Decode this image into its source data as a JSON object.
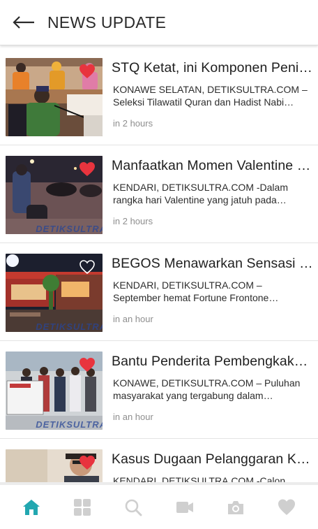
{
  "header": {
    "title": "NEWS UPDATE",
    "back_icon": "arrow-left-icon"
  },
  "articles": [
    {
      "title": "STQ Ketat, ini Komponen Penilaian",
      "excerpt": "KONAWE SELATAN, DETIKSULTRA.COM – Seleksi Tilawatil Quran dan Hadist Nabi…",
      "time": "in 2 hours",
      "favorited": true,
      "watermark": ""
    },
    {
      "title": "Manfaatkan Momen Valentine Day",
      "excerpt": "KENDARI, DETIKSULTRA.COM -Dalam rangka hari Valentine yang jatuh pada…",
      "time": "in 2 hours",
      "favorited": true,
      "watermark": "DETIKSULTRA"
    },
    {
      "title": "BEGOS Menawarkan Sensasi Baru",
      "excerpt": "KENDARI, DETIKSULTRA.COM – September hemat Fortune Frontone…",
      "time": "in an hour",
      "favorited": false,
      "watermark": "DETIKSULTRA"
    },
    {
      "title": "Bantu Penderita Pembengkakan Otak",
      "excerpt": "KONAWE, DETIKSULTRA.COM – Puluhan masyarakat yang tergabung dalam…",
      "time": "in an hour",
      "favorited": true,
      "watermark": "DETIKSULTRA"
    },
    {
      "title": "Kasus Dugaan Pelanggaran Kampanye",
      "excerpt": "KENDARI, DETIKSULTRA.COM -Calon…",
      "time": "",
      "favorited": true,
      "watermark": ""
    }
  ],
  "bottom_nav": {
    "items": [
      {
        "name": "home",
        "icon": "home-icon",
        "active": true
      },
      {
        "name": "categories",
        "icon": "grid-icon",
        "active": false
      },
      {
        "name": "search",
        "icon": "search-icon",
        "active": false
      },
      {
        "name": "video",
        "icon": "video-icon",
        "active": false
      },
      {
        "name": "photo",
        "icon": "camera-icon",
        "active": false
      },
      {
        "name": "favorites",
        "icon": "heart-icon",
        "active": false
      }
    ]
  },
  "colors": {
    "accent": "#22a7b0",
    "heart": "#e8343e",
    "nav_inactive": "#cfcfcf"
  }
}
